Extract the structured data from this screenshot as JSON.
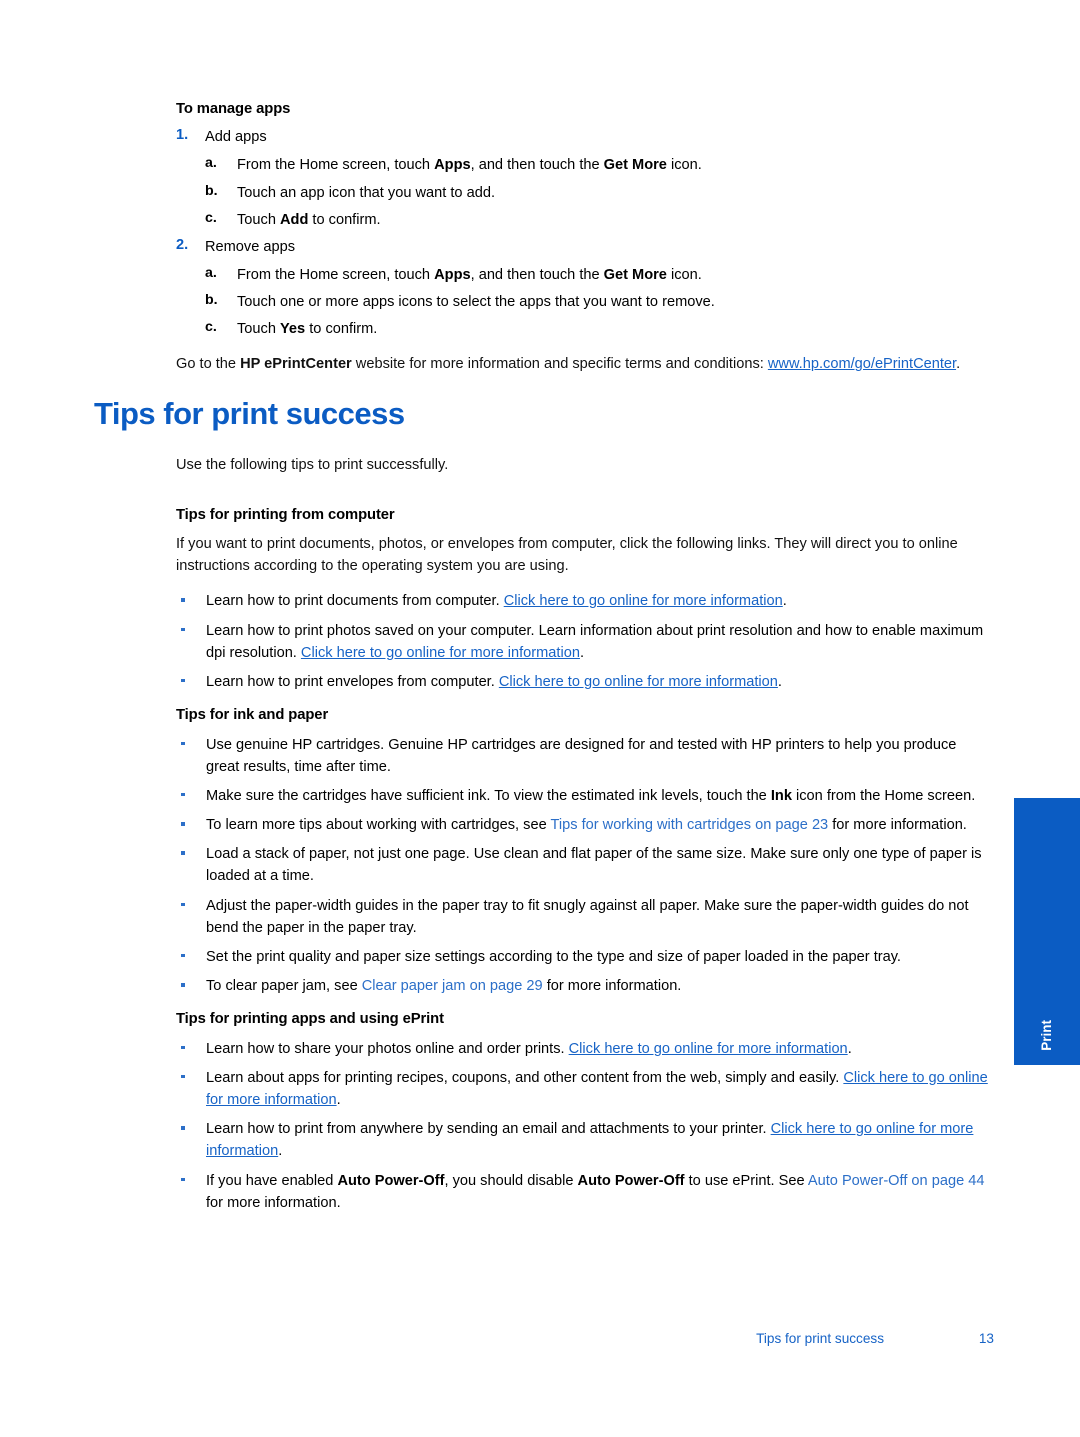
{
  "document": {
    "chapter_title": "Tips for print success",
    "side_tab_label": "Print",
    "footer": {
      "title": "Tips for print success",
      "page_number": "13"
    },
    "colors": {
      "heading_blue": "#0B5CC3",
      "link_blue": "#1763C6",
      "xref_blue": "#2C6FC8",
      "bullet_blue": "#2C6FC8",
      "body_black": "#111111",
      "tab_blue": "#0B5CC3"
    }
  },
  "manage_apps": {
    "heading": "To manage apps",
    "steps": [
      {
        "marker": "1.",
        "label": "Add apps",
        "substeps": [
          {
            "marker": "a.",
            "parts": [
              {
                "t": "From the Home screen, touch ",
                "s": "normal"
              },
              {
                "t": "Apps",
                "s": "bold"
              },
              {
                "t": ", and then touch the ",
                "s": "normal"
              },
              {
                "t": "Get More",
                "s": "bold"
              },
              {
                "t": " icon.",
                "s": "normal"
              }
            ]
          },
          {
            "marker": "b.",
            "parts": [
              {
                "t": "Touch an app icon that you want to add.",
                "s": "normal"
              }
            ]
          },
          {
            "marker": "c.",
            "parts": [
              {
                "t": "Touch ",
                "s": "normal"
              },
              {
                "t": "Add",
                "s": "bold"
              },
              {
                "t": " to confirm.",
                "s": "normal"
              }
            ]
          }
        ]
      },
      {
        "marker": "2.",
        "label": "Remove apps",
        "substeps": [
          {
            "marker": "a.",
            "parts": [
              {
                "t": "From the Home screen, touch ",
                "s": "normal"
              },
              {
                "t": "Apps",
                "s": "bold"
              },
              {
                "t": ", and then touch the ",
                "s": "normal"
              },
              {
                "t": "Get More",
                "s": "bold"
              },
              {
                "t": " icon.",
                "s": "normal"
              }
            ]
          },
          {
            "marker": "b.",
            "parts": [
              {
                "t": "Touch one or more apps icons to select the apps that you want to remove.",
                "s": "normal"
              }
            ]
          },
          {
            "marker": "c.",
            "parts": [
              {
                "t": "Touch ",
                "s": "normal"
              },
              {
                "t": "Yes",
                "s": "bold"
              },
              {
                "t": " to confirm.",
                "s": "normal"
              }
            ]
          }
        ]
      }
    ],
    "closing_paragraph": [
      {
        "t": "Go to the ",
        "s": "normal"
      },
      {
        "t": "HP ePrintCenter",
        "s": "bold"
      },
      {
        "t": " website for more information and specific terms and conditions: ",
        "s": "normal"
      },
      {
        "t": "www.hp.com/go/ePrintCenter",
        "s": "link"
      },
      {
        "t": ".",
        "s": "normal"
      }
    ]
  },
  "tips": {
    "intro": "Use the following tips to print successfully.",
    "sections": [
      {
        "heading": "Tips for printing from computer",
        "paragraph": "If you want to print documents, photos, or envelopes from computer, click the following links. They will direct you to online instructions according to the operating system you are using.",
        "bullets": [
          [
            {
              "t": "Learn how to print documents from computer. ",
              "s": "normal"
            },
            {
              "t": "Click here to go online for more information",
              "s": "link"
            },
            {
              "t": ".",
              "s": "normal"
            }
          ],
          [
            {
              "t": "Learn how to print photos saved on your computer. Learn information about print resolution and how to enable maximum dpi resolution. ",
              "s": "normal"
            },
            {
              "t": "Click here to go online for more information",
              "s": "link"
            },
            {
              "t": ".",
              "s": "normal"
            }
          ],
          [
            {
              "t": "Learn how to print envelopes from computer. ",
              "s": "normal"
            },
            {
              "t": "Click here to go online for more information",
              "s": "link"
            },
            {
              "t": ".",
              "s": "normal"
            }
          ]
        ]
      },
      {
        "heading": "Tips for ink and paper",
        "paragraph": "",
        "bullets": [
          [
            {
              "t": "Use genuine HP cartridges. Genuine HP cartridges are designed for and tested with HP printers to help you produce great results, time after time.",
              "s": "normal"
            }
          ],
          [
            {
              "t": "Make sure the cartridges have sufficient ink. To view the estimated ink levels, touch the ",
              "s": "normal"
            },
            {
              "t": "Ink",
              "s": "bold"
            },
            {
              "t": " icon from the Home screen.",
              "s": "normal"
            }
          ],
          [
            {
              "t": "To learn more tips about working with cartridges, see ",
              "s": "normal"
            },
            {
              "t": "Tips for working with cartridges on page 23",
              "s": "xref"
            },
            {
              "t": " for more information.",
              "s": "normal"
            }
          ],
          [
            {
              "t": "Load a stack of paper, not just one page. Use clean and flat paper of the same size. Make sure only one type of paper is loaded at a time.",
              "s": "normal"
            }
          ],
          [
            {
              "t": "Adjust the paper-width guides in the paper tray to fit snugly against all paper. Make sure the paper-width guides do not bend the paper in the paper tray.",
              "s": "normal"
            }
          ],
          [
            {
              "t": "Set the print quality and paper size settings according to the type and size of paper loaded in the paper tray.",
              "s": "normal"
            }
          ],
          [
            {
              "t": "To clear paper jam, see ",
              "s": "normal"
            },
            {
              "t": "Clear paper jam on page 29",
              "s": "xref"
            },
            {
              "t": " for more information.",
              "s": "normal"
            }
          ]
        ]
      },
      {
        "heading": "Tips for printing apps and using ePrint",
        "paragraph": "",
        "bullets": [
          [
            {
              "t": "Learn how to share your photos online and order prints. ",
              "s": "normal"
            },
            {
              "t": "Click here to go online for more information",
              "s": "link"
            },
            {
              "t": ".",
              "s": "normal"
            }
          ],
          [
            {
              "t": "Learn about apps for printing recipes, coupons, and other content from the web, simply and easily. ",
              "s": "normal"
            },
            {
              "t": "Click here to go online for more information",
              "s": "link"
            },
            {
              "t": ".",
              "s": "normal"
            }
          ],
          [
            {
              "t": "Learn how to print from anywhere by sending an email and attachments to your printer. ",
              "s": "normal"
            },
            {
              "t": "Click here to go online for more information",
              "s": "link"
            },
            {
              "t": ".",
              "s": "normal"
            }
          ],
          [
            {
              "t": "If you have enabled ",
              "s": "normal"
            },
            {
              "t": "Auto Power-Off",
              "s": "bold"
            },
            {
              "t": ", you should disable ",
              "s": "normal"
            },
            {
              "t": "Auto Power-Off",
              "s": "bold"
            },
            {
              "t": " to use ePrint. See ",
              "s": "normal"
            },
            {
              "t": "Auto Power-Off on page 44",
              "s": "xref"
            },
            {
              "t": " for more information.",
              "s": "normal"
            }
          ]
        ]
      }
    ]
  }
}
